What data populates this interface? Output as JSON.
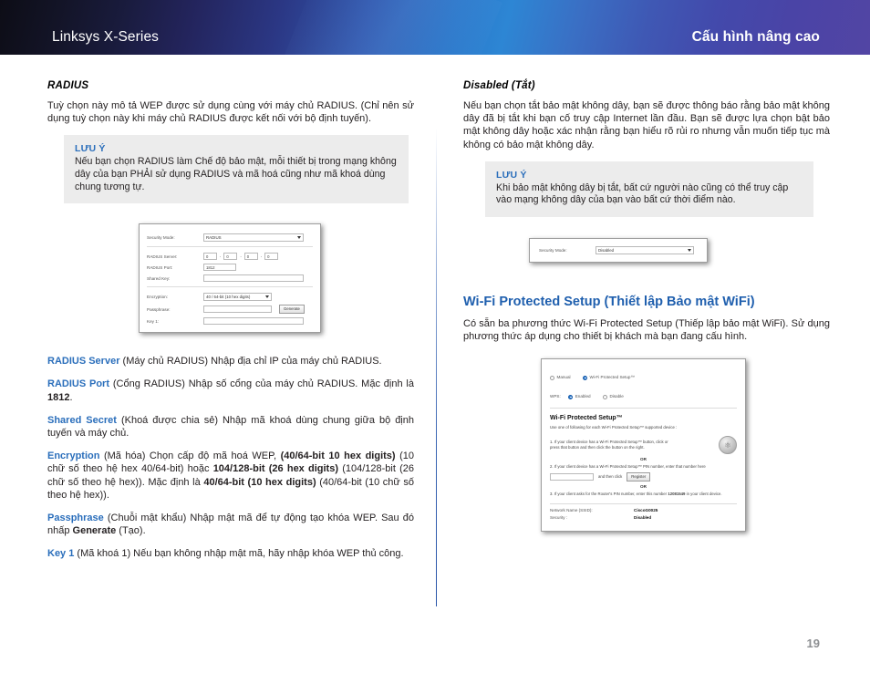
{
  "header": {
    "product": "Linksys X-Series",
    "chapter": "Cấu hình nâng cao"
  },
  "left_column": {
    "heading": "RADIUS",
    "intro": "Tuỳ chọn này mô tả WEP được sử dụng cùng với máy chủ RADIUS. (Chỉ nên sử dụng tuỳ chọn này khi máy chủ RADIUS được kết nối với bộ định tuyến).",
    "note": {
      "title": "LƯU Ý",
      "text": "Nếu bạn chọn RADIUS làm Chế độ bảo mật, mỗi thiết bị trong mạng không dây của bạn PHẢI sử dụng RADIUS và mã hoá cũng như mã khoá dùng chung tương tự."
    },
    "figure": {
      "name": "radius-settings-screenshot",
      "security_mode_label": "Security Mode:",
      "security_mode_value": "RADIUS",
      "radius_server_label": "RADIUS Server:",
      "radius_server_octets": [
        "0",
        "0",
        "0",
        "0"
      ],
      "radius_port_label": "RADIUS Port:",
      "radius_port_value": "1812",
      "shared_key_label": "Shared Key:",
      "shared_key_value": "",
      "encryption_label": "Encryption:",
      "encryption_value": "40 / 64-bit (10 hex digits)",
      "passphrase_label": "Passphrase:",
      "passphrase_value": "",
      "generate_button": "Generate",
      "key1_label": "Key 1:",
      "key1_value": ""
    },
    "definitions": [
      {
        "term": "RADIUS Server",
        "rest": " (Máy chủ RADIUS)  Nhập địa chỉ IP của máy chủ RADIUS."
      },
      {
        "term": "RADIUS Port",
        "rest_a": " (Cổng RADIUS)  Nhập số cổng của máy chủ RADIUS. Mặc định là ",
        "bold_a": "1812",
        "rest_b": "."
      },
      {
        "term": "Shared Secret",
        "rest": " (Khoá được chia sẻ)  Nhập mã khoá dùng chung giữa bộ định tuyến và máy chủ."
      },
      {
        "term": "Encryption",
        "rest_a": " (Mã hóa) Chọn cấp độ mã hoá WEP, ",
        "bold_a": "(40/64-bit 10 hex digits)",
        "rest_b": " (10 chữ số theo hệ hex 40/64-bit) hoặc ",
        "bold_b": "104/128-bit (26 hex digits)",
        "rest_c": " (104/128-bit (26 chữ số theo hệ hex)). Mặc định là ",
        "bold_c": "40/64-bit (10 hex digits)",
        "rest_d": " (40/64-bit (10 chữ số theo hệ hex))."
      },
      {
        "term": "Passphrase",
        "rest_a": " (Chuỗi mật khẩu)  Nhập mật mã để tự động tạo khóa WEP. Sau đó nhấp ",
        "bold_a": "Generate",
        "rest_b": " (Tạo)."
      },
      {
        "term": "Key 1",
        "rest": " (Mã khoá 1)  Nếu bạn không nhập mật mã, hãy nhập khóa WEP thủ công."
      }
    ]
  },
  "right_column": {
    "heading": "Disabled (Tắt)",
    "intro": "Nếu bạn chọn tắt bảo mật không dây, bạn sẽ được thông báo rằng bảo mật không dây đã bị tắt khi bạn cố truy cập Internet lần đầu. Bạn sẽ được lựa chọn bật bảo mật không dây hoặc xác nhận rằng bạn hiểu rõ rủi ro nhưng vẫn muốn tiếp tục mà không có bảo mật không dây.",
    "note": {
      "title": "LƯU Ý",
      "text": "Khi bảo mật không dây bị tắt, bất cứ người nào cũng có thể truy cập vào mạng không dây của bạn vào bất cứ thời điểm nào."
    },
    "figure_disabled": {
      "name": "security-mode-disabled-screenshot",
      "security_mode_label": "Security Mode:",
      "security_mode_value": "Disabled"
    },
    "wps_heading": "Wi-Fi Protected Setup (Thiết lập Bảo mật WiFi)",
    "wps_intro": "Có sẵn ba phương thức Wi-Fi Protected Setup (Thiếp lập bảo mật WiFi). Sử dụng phương thức áp dụng cho thiết bị khách mà bạn đang cấu hình.",
    "figure_wps": {
      "name": "wifi-protected-setup-screenshot",
      "opt_manual": "Manual",
      "opt_wps": "Wi-Fi Protected Setup™",
      "wps_label": "WPS:",
      "opt_enabled": "Enabled",
      "opt_disable": "Disable",
      "title": "Wi-Fi Protected Setup™",
      "subtitle": "Use one of following for each Wi-Fi Protected Setup™ supported device :",
      "step1": "1. If your client device has a Wi-Fi Protected Setup™ button, click or press that button and then click the button on the right.",
      "or": "OR",
      "step2": "2. If your client device has a Wi-Fi Protected Setup™ PIN number, enter that number here",
      "step2_after": "and then click",
      "register_button": "Register",
      "step3_a": "3. If your client asks for the Router's PIN number, enter this number ",
      "step3_pin": "12081549",
      "step3_b": " in your client device.",
      "ssid_label": "Network Name (SSID):",
      "ssid_value": "CiscoG0025",
      "security_label": "Security :",
      "security_value": "Disabled",
      "pin_field_value": ""
    }
  },
  "footer": {
    "page_number": "19"
  }
}
